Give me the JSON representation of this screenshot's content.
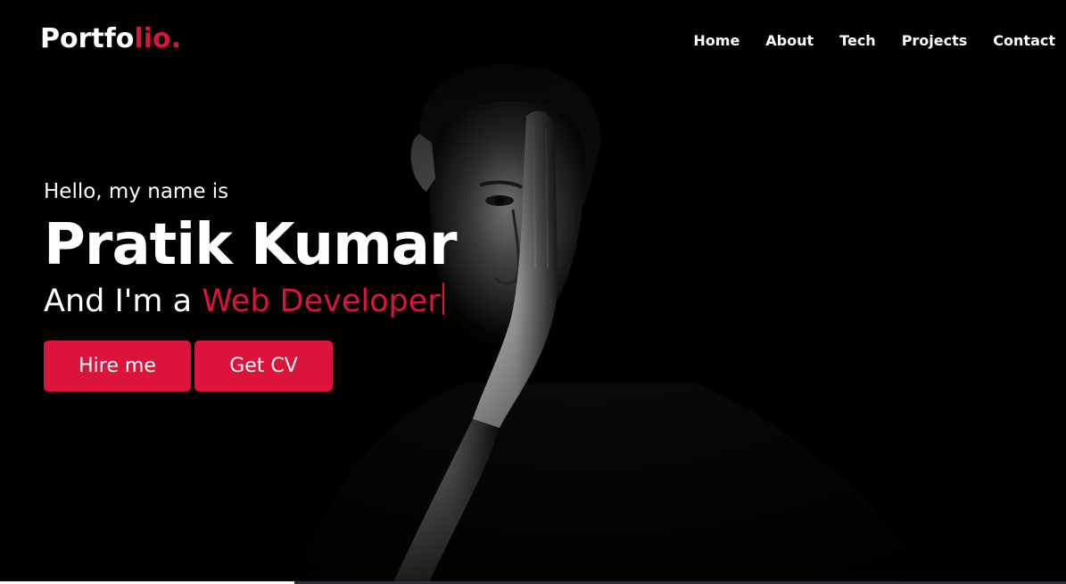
{
  "logo": {
    "main": "Portfo",
    "accent": "lio."
  },
  "nav": {
    "items": [
      "Home",
      "About",
      "Tech",
      "Projects",
      "Contact"
    ]
  },
  "hero": {
    "greeting": "Hello, my name is",
    "name": "Pratik Kumar",
    "role_prefix": "And I'm a",
    "role_typed": "Web Developer",
    "buttons": {
      "hire": "Hire me",
      "cv": "Get CV"
    }
  },
  "colors": {
    "accent": "#dc143c",
    "background": "#000000",
    "text": "#ffffff"
  }
}
